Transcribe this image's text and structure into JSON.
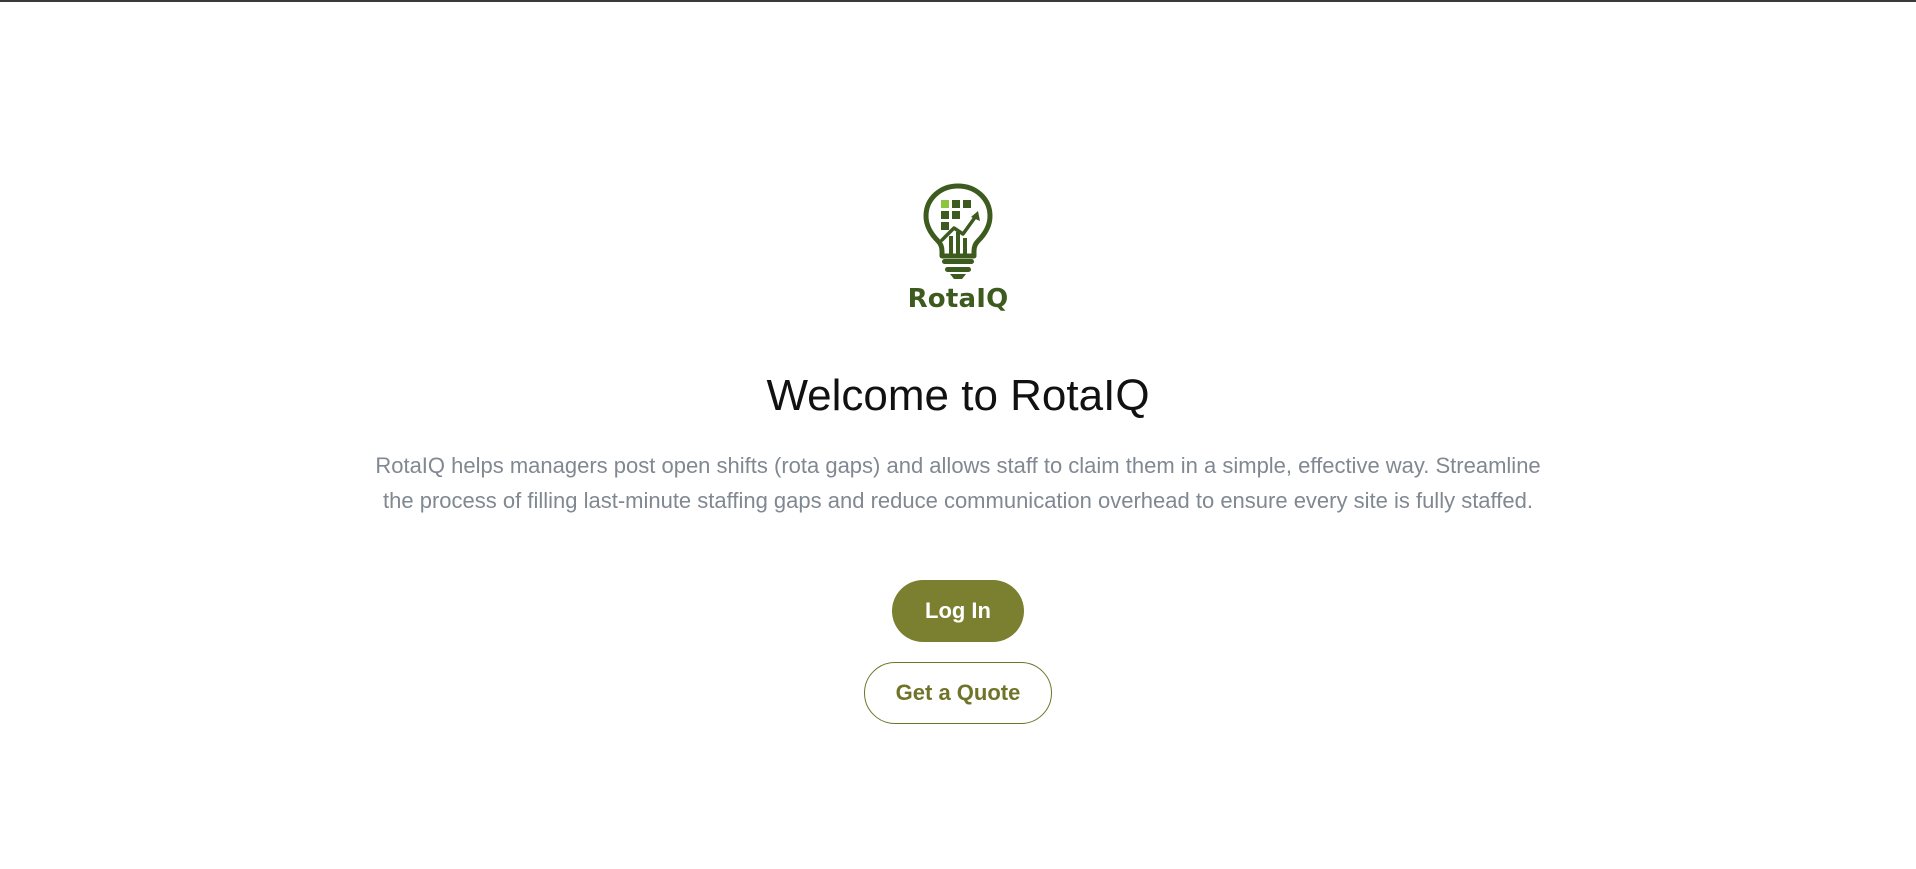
{
  "brand": {
    "logo_text": "RotaIQ",
    "logo_icon": "lightbulb-chart-icon",
    "colors": {
      "primary": "#7a8030",
      "logo_green": "#3d5a1f",
      "logo_accent": "#8cc63f"
    }
  },
  "hero": {
    "title": "Welcome to RotaIQ",
    "description": "RotaIQ helps managers post open shifts (rota gaps) and allows staff to claim them in a simple, effective way. Streamline the process of filling last-minute staffing gaps and reduce communication overhead to ensure every site is fully staffed."
  },
  "actions": {
    "login_label": "Log In",
    "quote_label": "Get a Quote"
  }
}
